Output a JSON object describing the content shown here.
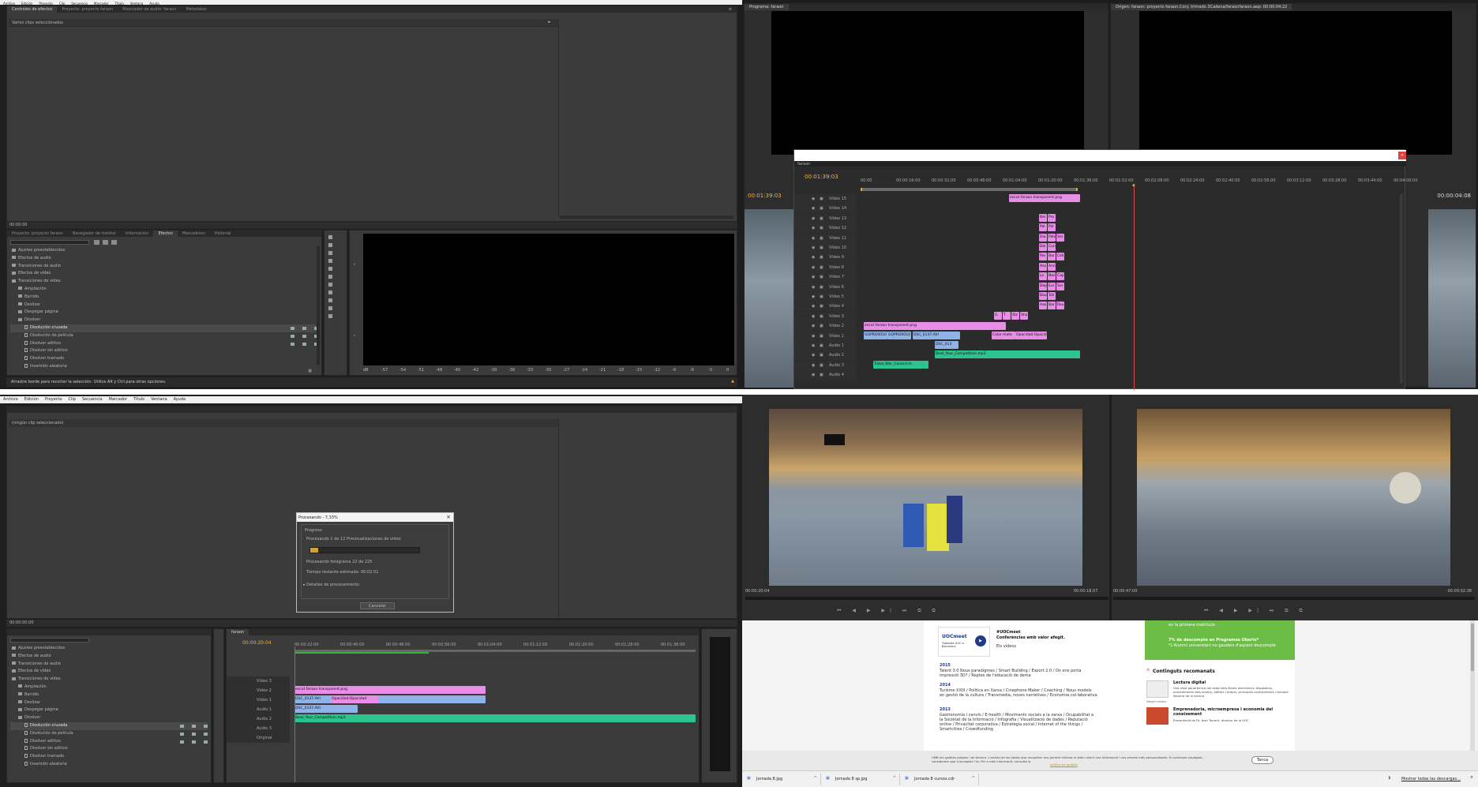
{
  "q1": {
    "menu": [
      "Archivo",
      "Edición",
      "Proyecto",
      "Clip",
      "Secuencia",
      "Marcador",
      "Título",
      "Ventana",
      "Ayuda"
    ],
    "source_tabs": [
      "Controles de efectos",
      "Proyecto: proyecto faraon",
      "Mezclador de audio: faraon",
      "Metadatos"
    ],
    "no_clip": "Varios clips seleccionados",
    "timecode": "00:00:00",
    "effects_tabs": [
      "Proyecto: proyecto faraon",
      "Navegador de medios",
      "Información",
      "Efectos",
      "Marcadores",
      "Historial"
    ],
    "effects_tree": [
      {
        "label": "Ajustes preestablecidos",
        "type": "folder",
        "indent": 0
      },
      {
        "label": "Efectos de audio",
        "type": "folder",
        "indent": 0
      },
      {
        "label": "Transiciones de audio",
        "type": "folder",
        "indent": 0
      },
      {
        "label": "Efectos de vídeo",
        "type": "folder",
        "indent": 0
      },
      {
        "label": "Transiciones de vídeo",
        "type": "folder",
        "indent": 0
      },
      {
        "label": "Ampliación",
        "type": "folder",
        "indent": 1
      },
      {
        "label": "Barrido",
        "type": "folder",
        "indent": 1
      },
      {
        "label": "Deslizar",
        "type": "folder",
        "indent": 1
      },
      {
        "label": "Despegar página",
        "type": "folder",
        "indent": 1
      },
      {
        "label": "Disolver",
        "type": "folder",
        "indent": 1
      },
      {
        "label": "Disolución cruzada",
        "type": "item",
        "indent": 2,
        "selected": true
      },
      {
        "label": "Disolución de película",
        "type": "item",
        "indent": 2
      },
      {
        "label": "Disolver aditivo",
        "type": "item",
        "indent": 2
      },
      {
        "label": "Disolver sin aditivo",
        "type": "item",
        "indent": 2
      },
      {
        "label": "Disolver tramado",
        "type": "item",
        "indent": 2
      },
      {
        "label": "Inversión aleatoria",
        "type": "item",
        "indent": 2
      }
    ],
    "status": "Arrastre borde para recortar la selección. Utilice Alt y Ctrl para otras opciones.",
    "meter_labels": [
      "dB",
      "-57",
      "-54",
      "-51",
      "-48",
      "-45",
      "-42",
      "-39",
      "-36",
      "-33",
      "-30",
      "-27",
      "-24",
      "-21",
      "-18",
      "-15",
      "-12",
      "-9",
      "-6",
      "-3",
      "0"
    ]
  },
  "q2": {
    "program_title": "Programa: faraon",
    "source_title": "Origen: faraon: proyecto faraon.Conj: trimado 3Cadena/faraonfaraon.aep: 00:00:04:22",
    "program_tc": "00:01:39:03",
    "source_tc": "00:00:04:08",
    "timeline_tab": "faraon",
    "timeline_tc": "00:01:39:03",
    "ruler": [
      "00:00",
      "00:00:16:00",
      "00:00:32:00",
      "00:00:48:00",
      "00:01:04:00",
      "00:01:20:00",
      "00:01:36:00",
      "00:01:52:00",
      "00:02:08:00",
      "00:02:24:00",
      "00:02:40:00",
      "00:02:56:00",
      "00:03:12:00",
      "00:03:28:00",
      "00:03:44:00",
      "00:04:00:00"
    ],
    "tracks": [
      "Vídeo 15",
      "Vídeo 14",
      "Vídeo 13",
      "Vídeo 12",
      "Vídeo 11",
      "Vídeo 10",
      "Vídeo 9",
      "Vídeo 8",
      "Vídeo 7",
      "Vídeo 6",
      "Vídeo 5",
      "Vídeo 4",
      "Vídeo 3",
      "Vídeo 2",
      "Vídeo 1",
      "Audio 1",
      "Audio 2",
      "Audio 3",
      "Audio 4"
    ],
    "clip_png": "escut faraon transparent.png",
    "clip_png2": "escut faraon transparent.png",
    "clip_gopro": "GOPRO0010",
    "clip_gopro2": "GOPRO0010",
    "clip_dsc": "DSC_0137.AVI",
    "clip_color": "Color mate",
    "clip_opacidad": "Opacidad:Opacidad",
    "clip_dsc_a": "DSC_013",
    "clip_beat": "Beat_Your_Competition.mp3",
    "clip_tribal": "Tribal_War_Council.m",
    "mini": [
      [
        "Bei",
        "Pro"
      ],
      [
        "Pal",
        "Pal"
      ],
      [
        "Dia",
        "Pals",
        "Sor"
      ],
      [
        "Del",
        "Cun"
      ],
      [
        "Rei",
        "Bar",
        "Cell"
      ],
      [
        "Aso",
        "Ann"
      ],
      [
        "Lo",
        "Noc",
        "Cap"
      ],
      [
        "Dep",
        "Eur",
        "Sor"
      ],
      [
        "Bou",
        "Tali"
      ],
      [
        "Aas",
        "Bar",
        "Rou"
      ],
      [
        "G",
        "T",
        "Alz",
        "Alia"
      ]
    ]
  },
  "q3": {
    "menu": [
      "Archivo",
      "Edición",
      "Proyecto",
      "Clip",
      "Secuencia",
      "Marcador",
      "Título",
      "Ventana",
      "Ayuda"
    ],
    "no_clip": "(ningún clip seleccionado)",
    "timecode": "00:00:00:00",
    "dialog": {
      "title": "Procesando - 7,33%",
      "section": "Progreso",
      "line1": "Procesando 1 de 12 Previsualizaciones de vídeo",
      "progress": 0.07,
      "line2": "Procesando fotograma 22 de 225",
      "line3": "Tiempo restante estimado: 00:02:51",
      "details": "Detalles de procesamiento",
      "cancel": "Cancelar"
    },
    "effects_tree": [
      {
        "label": "Ajustes preestablecidos",
        "type": "folder",
        "indent": 0
      },
      {
        "label": "Efectos de audio",
        "type": "folder",
        "indent": 0
      },
      {
        "label": "Transiciones de audio",
        "type": "folder",
        "indent": 0
      },
      {
        "label": "Efectos de vídeo",
        "type": "folder",
        "indent": 0
      },
      {
        "label": "Transiciones de vídeo",
        "type": "folder",
        "indent": 0
      },
      {
        "label": "Ampliación",
        "type": "folder",
        "indent": 1
      },
      {
        "label": "Barrido",
        "type": "folder",
        "indent": 1
      },
      {
        "label": "Deslizar",
        "type": "folder",
        "indent": 1
      },
      {
        "label": "Despegar página",
        "type": "folder",
        "indent": 1
      },
      {
        "label": "Disolver",
        "type": "folder",
        "indent": 1
      },
      {
        "label": "Disolución cruzada",
        "type": "item",
        "indent": 2,
        "selected": true
      },
      {
        "label": "Disolución de película",
        "type": "item",
        "indent": 2
      },
      {
        "label": "Disolver aditivo",
        "type": "item",
        "indent": 2
      },
      {
        "label": "Disolver sin aditivo",
        "type": "item",
        "indent": 2
      },
      {
        "label": "Disolver tramado",
        "type": "item",
        "indent": 2
      },
      {
        "label": "Inversión aleatoria",
        "type": "item",
        "indent": 2
      }
    ],
    "seq_tab": "faraon",
    "seq_tc": "00:00:20:04",
    "ruler": [
      "00:00:22:00",
      "00:00:40:00",
      "00:00:48:00",
      "00:00:56:00",
      "00:01:04:00",
      "00:01:12:00",
      "00:01:20:00",
      "00:01:28:00",
      "00:01:36:00"
    ],
    "tracks": [
      "Vídeo 3",
      "Vídeo 2",
      "Vídeo 1",
      "Audio 1",
      "Audio 2",
      "Audio 3",
      "Original"
    ],
    "clip_png": "escut faraon transparent.png",
    "clip_dsc": "DSC_0137.AVI",
    "clip_opacidad": "Opacidad:Opacidad",
    "clip_dsc_a": "DSC_0137.AVI",
    "clip_beat": "Beat_Your_Competition.mp3"
  },
  "q4": {
    "left_tc": "00:00:20:04",
    "left_tc2": "00:00:18:07",
    "right_tc": "00:00:47:00",
    "right_tc2": "00:00:02:38",
    "web": {
      "uoc_title": "UOCmeet",
      "uoc_sub": "Trobades UOC a Barcelona",
      "uoc_h": "#UOCmeet",
      "uoc_line": "Conferències amb valor afegit.",
      "uoc_video": "Els vídeos",
      "y2015": "2015",
      "t2015": "Talent 3.0 Nous paradigmes / Smart Building / Esport 2.0 / On ens porta impressió 3D? / Reptes de l'educació de dema",
      "y2014": "2014",
      "t2014": "Turisme XXIII / Política en Xarxa / Cinephone Maker / Coaching / Nous models en gestió de la cultura / Transmedia, noves narratives / Economia col·laborativa",
      "y2013": "2013",
      "t2013": "Gastronomia i canvis / E-health / Moviments socials a la xarxa / Ocupabilitat a la Societat de la Informació / Infografia / Visualització de dades / Reputació online / Privacitat corporativa / Estratègia social / Internet of the things / Smartcities / Crowdfunding",
      "promo1": "en la primera matrícula",
      "promo2": "7% de descompte en Programes Oberts*",
      "promo3": "*L'Alumni universitari no gaudeix d'aquest descompte",
      "reco_h": "Continguts recomanats",
      "reco1": "Lectura digital",
      "reco1d": "Una visió panoràmica del estat dels llibres electrònics: dispositius, procediments dels lectors, editors i autors, principals controvèrsies i formats llibreria de la lectura",
      "reco1m": "Afegit mateix",
      "reco2": "Emprenedoria, microempresa i economia del coneixement",
      "reco2d": "Presentació de Dr. Joan Torrent, director de la UOC",
      "cookie": "UMB em galetes pròpies i de tercers. L'anàlisi de les dades que recopilem ens permet millorar el web i oferir una informació i uns serveis més personalitzats. Si continues navegant, considerem que n'acceptes l'ús. Per a més informació, consulta la",
      "cookie_link": "política de galetes",
      "close": "Tanca"
    },
    "downloads": [
      "Jornada 8.jpg",
      "Jornada 8 sp.jpg",
      "Jornada 8 cursos.cdr"
    ],
    "show_all": "Mostrar todas las descargas..."
  }
}
